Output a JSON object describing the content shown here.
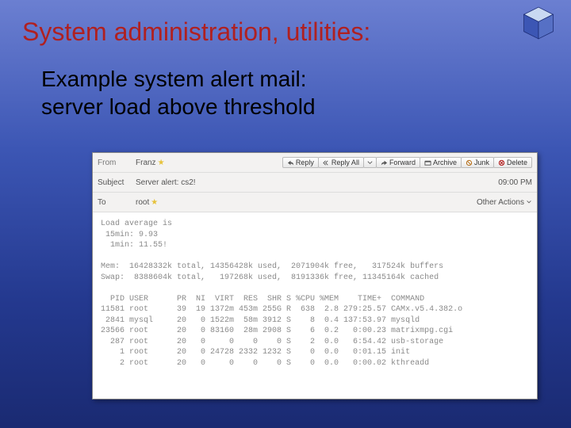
{
  "slide": {
    "title": "System administration, utilities:",
    "subtitle_line1": "Example system alert mail:",
    "subtitle_line2": "server load above threshold"
  },
  "mail": {
    "labels": {
      "from": "From",
      "subject": "Subject",
      "to": "To"
    },
    "from": "Franz",
    "subject": "Server alert: cs2!",
    "to": "root",
    "time": "09:00 PM",
    "other_actions": "Other Actions"
  },
  "buttons": {
    "reply": "Reply",
    "reply_all": "Reply All",
    "forward": "Forward",
    "archive": "Archive",
    "junk": "Junk",
    "delete": "Delete"
  },
  "body": {
    "load_hdr": "Load average is",
    "load_15": " 15min: 9.93",
    "load_1": "  1min: 11.55!",
    "mem": "Mem:  16428332k total, 14356428k used,  2071904k free,   317524k buffers",
    "swap": "Swap:  8388604k total,   197268k used,  8191336k free, 11345164k cached",
    "proc_hdr": "  PID USER      PR  NI  VIRT  RES  SHR S %CPU %MEM    TIME+  COMMAND",
    "procs": [
      "11581 root      39  19 1372m 453m 255G R  638  2.8 279:25.57 CAMx.v5.4.382.o",
      " 2841 mysql     20   0 1522m  58m 3912 S    8  0.4 137:53.97 mysqld",
      "23566 root      20   0 83160  28m 2908 S    6  0.2   0:00.23 matrixmpg.cgi",
      "  287 root      20   0     0    0    0 S    2  0.0   6:54.42 usb-storage",
      "    1 root      20   0 24728 2332 1232 S    0  0.0   0:01.15 init",
      "    2 root      20   0     0    0    0 S    0  0.0   0:00.02 kthreadd"
    ]
  }
}
